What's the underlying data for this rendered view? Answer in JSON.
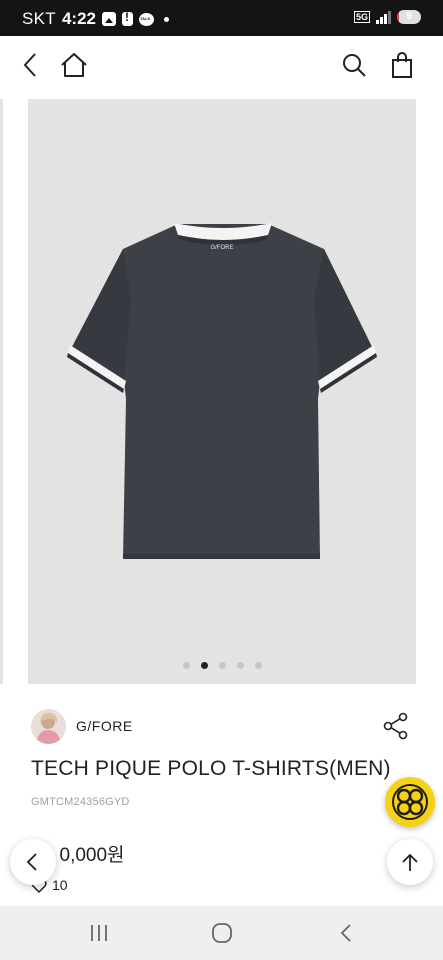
{
  "status_bar": {
    "carrier": "SKT",
    "time": "4:22",
    "network": "5G",
    "battery": "9",
    "battery_level": 0.09,
    "left_icons": [
      "gallery-icon",
      "alert-icon",
      "talk-icon"
    ]
  },
  "nav": {
    "icons": [
      "back-arrow-icon",
      "home-icon",
      "search-icon",
      "shopping-bag-icon"
    ]
  },
  "product_image": {
    "garment_logo": "G/FORE",
    "slide_count": 5,
    "active_slide": 2,
    "background_color": "#e3e3e3",
    "shirt_color": "#3c4047"
  },
  "product": {
    "brand": "G/FORE",
    "title": "TECH PIQUE POLO T-SHIRTS(MEN)",
    "code": "GMTCM24356GYD",
    "price": " 0,000원",
    "likes": "10"
  },
  "floating": {
    "badge_color": "#f6d214",
    "icons": [
      "golf-badge-icon",
      "chevron-left-icon",
      "arrow-up-icon"
    ]
  },
  "system_nav": {
    "icons": [
      "recent-apps-icon",
      "home-circle-icon",
      "back-chevron-icon"
    ]
  }
}
